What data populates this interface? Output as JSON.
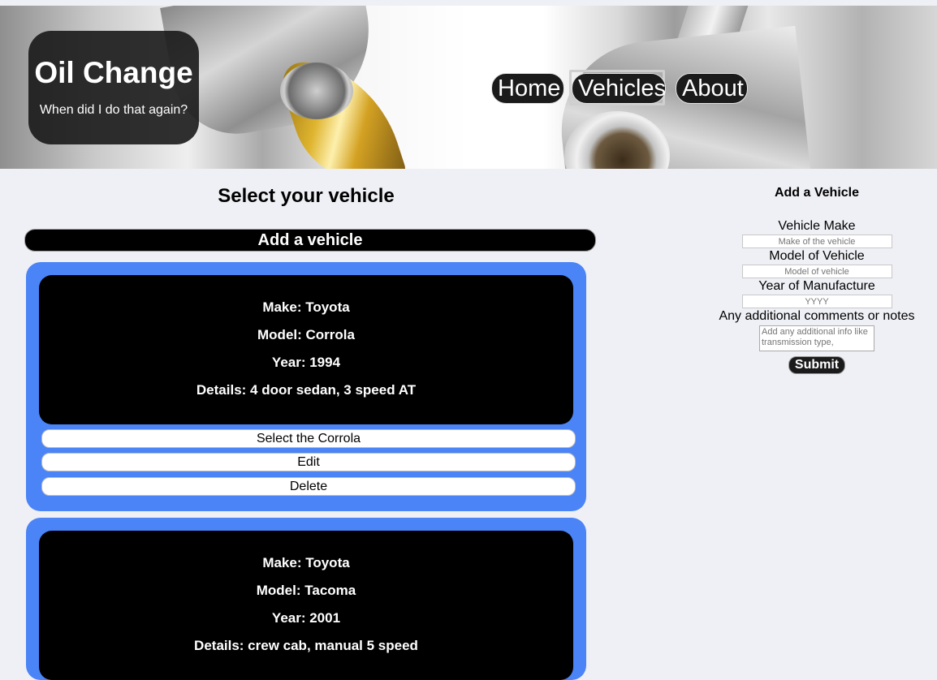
{
  "header": {
    "title": "Oil Change",
    "tagline": "When did I do that again?",
    "nav": [
      {
        "label": "Home"
      },
      {
        "label": "Vehicles"
      },
      {
        "label": "About"
      }
    ]
  },
  "main": {
    "title": "Select your vehicle",
    "add_button": "Add a vehicle",
    "vehicles": [
      {
        "make": "Make: Toyota",
        "model": "Model: Corrola",
        "year": "Year: 1994",
        "details": "Details: 4 door sedan, 3 speed AT",
        "select_label": "Select the Corrola",
        "edit_label": "Edit",
        "delete_label": "Delete"
      },
      {
        "make": "Make: Toyota",
        "model": "Model: Tacoma",
        "year": "Year: 2001",
        "details": "Details: crew cab, manual 5 speed"
      }
    ]
  },
  "form": {
    "title": "Add a Vehicle",
    "make_label": "Vehicle Make",
    "make_placeholder": "Make of the vehicle",
    "model_label": "Model of Vehicle",
    "model_placeholder": "Model of vehicle",
    "year_label": "Year of Manufacture",
    "year_placeholder": "YYYY",
    "notes_label": "Any additional comments or notes",
    "notes_placeholder": "Add any additional info like transmission type,",
    "submit_label": "Submit"
  },
  "colors": {
    "card_blue": "#4a84f7",
    "page_bg": "#eff0f5",
    "dark": "#1b1b1b"
  }
}
